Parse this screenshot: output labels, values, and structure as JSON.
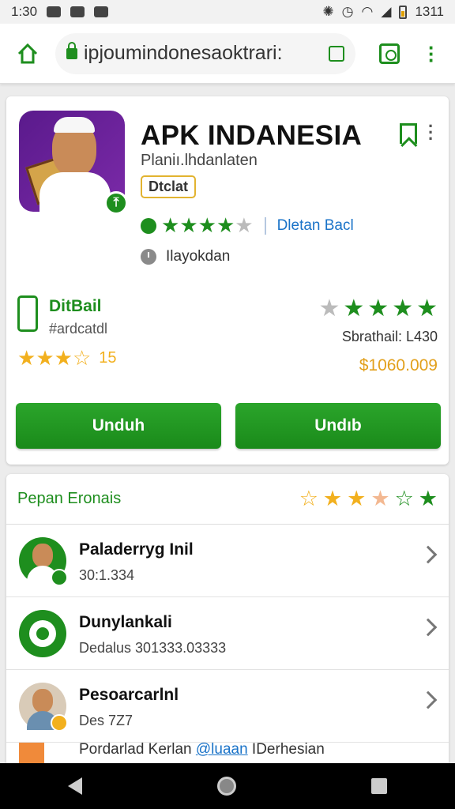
{
  "status": {
    "time": "1:30",
    "right_text": "1311"
  },
  "browser": {
    "url": "ipjoumindonesaoktrari:"
  },
  "app": {
    "title": "APK INDANESIA",
    "developer": "Planiı.lhdanlaten",
    "tag": "Dtclat",
    "rating_stars": [
      "g",
      "g",
      "g",
      "g",
      "grey"
    ],
    "rating_link": "Dletan Bacl",
    "status_text": "Ilayokdan"
  },
  "stats": {
    "left_label": "DitBail",
    "left_sub": "#ardcatdl",
    "left_stars": [
      "gold",
      "gold",
      "gold",
      "gold-outline"
    ],
    "left_count": "15",
    "right_stars": [
      "grey",
      "g",
      "g",
      "g",
      "g"
    ],
    "sales": "Sbrathail: L430",
    "price": "$1060.009"
  },
  "buttons": {
    "unduh_1": "Unduh",
    "unduh_2": "Undıb"
  },
  "section": {
    "title": "Pepan Eronais",
    "stars": [
      "gold-outline",
      "gold",
      "gold",
      "peach",
      "g-outline",
      "g"
    ]
  },
  "items": [
    {
      "name": "Paladerryg Inil",
      "sub": "30:1.334"
    },
    {
      "name": "Dunylankali",
      "sub": "Dedalus 301333.03333"
    },
    {
      "name": "Pesoarcarlnl",
      "sub": "Des 7Z7"
    }
  ],
  "last_line": {
    "prefix": "Pordarlad Kerlan ",
    "link": "@luaan",
    "suffix": " IDerhesian"
  }
}
